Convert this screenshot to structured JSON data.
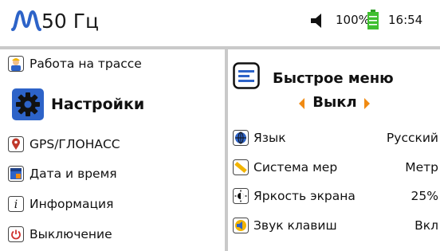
{
  "header": {
    "frequency": "50 Гц",
    "battery_percent": "100%",
    "time": "16:54",
    "icons": [
      "signal-wave-icon",
      "speaker-icon",
      "battery-icon"
    ]
  },
  "menu": {
    "items": [
      {
        "label": "Работа на трассе",
        "icon": "worker-icon"
      },
      {
        "label": "Настройки",
        "icon": "gear-icon"
      },
      {
        "label": "GPS/ГЛОНАСС",
        "icon": "location-pin-icon"
      },
      {
        "label": "Дата и время",
        "icon": "calendar-icon"
      },
      {
        "label": "Информация",
        "icon": "info-icon"
      },
      {
        "label": "Выключение",
        "icon": "power-icon"
      }
    ]
  },
  "quick_menu": {
    "title": "Быстрое меню",
    "value": "Выкл",
    "icon": "menu-lines-icon"
  },
  "settings": [
    {
      "name": "Язык",
      "value": "Русский",
      "icon": "globe-icon"
    },
    {
      "name": "Система мер",
      "value": "Метр",
      "icon": "ruler-icon"
    },
    {
      "name": "Яркость экрана",
      "value": "25%",
      "icon": "brightness-icon"
    },
    {
      "name": "Звук клавиш",
      "value": "Вкл",
      "icon": "key-sound-icon"
    }
  ],
  "colors": {
    "accent_blue": "#2d63c8",
    "arrow_orange": "#f08a12",
    "battery_green": "#3fbf2f",
    "divider_gray": "#c9c9c9"
  }
}
